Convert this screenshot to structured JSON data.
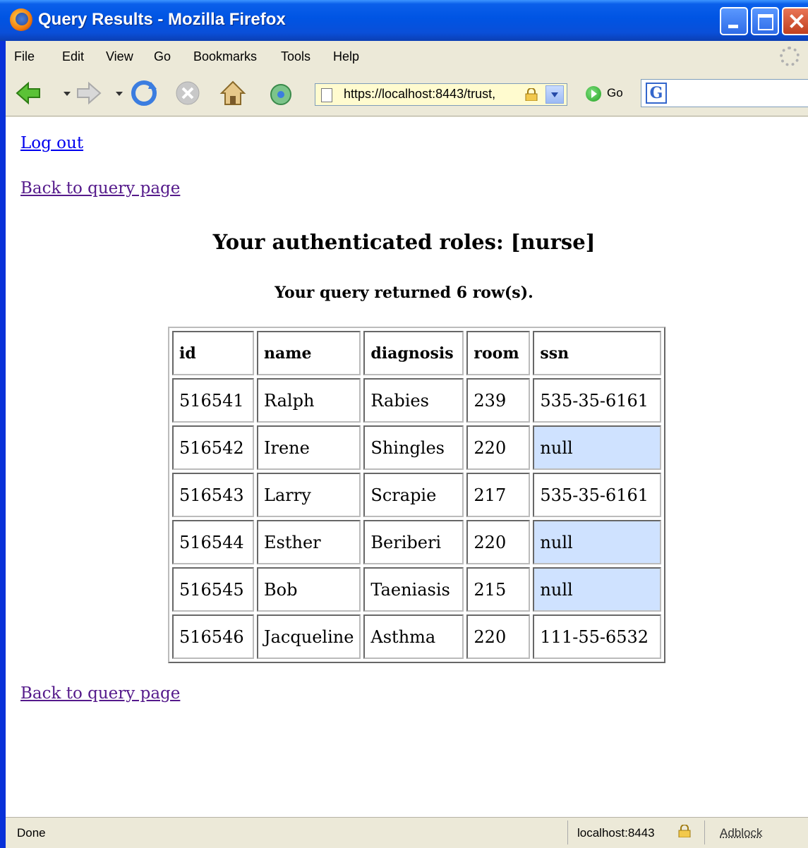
{
  "window": {
    "title": "Query Results - Mozilla Firefox"
  },
  "menubar": {
    "items": [
      "File",
      "Edit",
      "View",
      "Go",
      "Bookmarks",
      "Tools",
      "Help"
    ]
  },
  "toolbar": {
    "url": "https://localhost:8443/trust,",
    "go_label": "Go",
    "search_engine_glyph": "G"
  },
  "page": {
    "logout_label": "Log out",
    "back_label": "Back to query page",
    "roles_heading": "Your authenticated roles: [nurse]",
    "row_count_text": "Your query returned 6 row(s).",
    "table": {
      "columns": [
        "id",
        "name",
        "diagnosis",
        "room",
        "ssn"
      ],
      "rows": [
        [
          "516541",
          "Ralph",
          "Rabies",
          "239",
          "535-35-6161"
        ],
        [
          "516542",
          "Irene",
          "Shingles",
          "220",
          "null"
        ],
        [
          "516543",
          "Larry",
          "Scrapie",
          "217",
          "535-35-6161"
        ],
        [
          "516544",
          "Esther",
          "Beriberi",
          "220",
          "null"
        ],
        [
          "516545",
          "Bob",
          "Taeniasis",
          "215",
          "null"
        ],
        [
          "516546",
          "Jacqueline",
          "Asthma",
          "220",
          "111-55-6532"
        ]
      ],
      "null_highlight_color": "#cfe2ff"
    }
  },
  "statusbar": {
    "status": "Done",
    "host": "localhost:8443",
    "adblock": "Adblock"
  },
  "icons": {
    "back": "back-arrow-icon",
    "forward": "forward-arrow-icon",
    "reload": "reload-icon",
    "stop": "stop-icon",
    "home": "home-icon"
  }
}
